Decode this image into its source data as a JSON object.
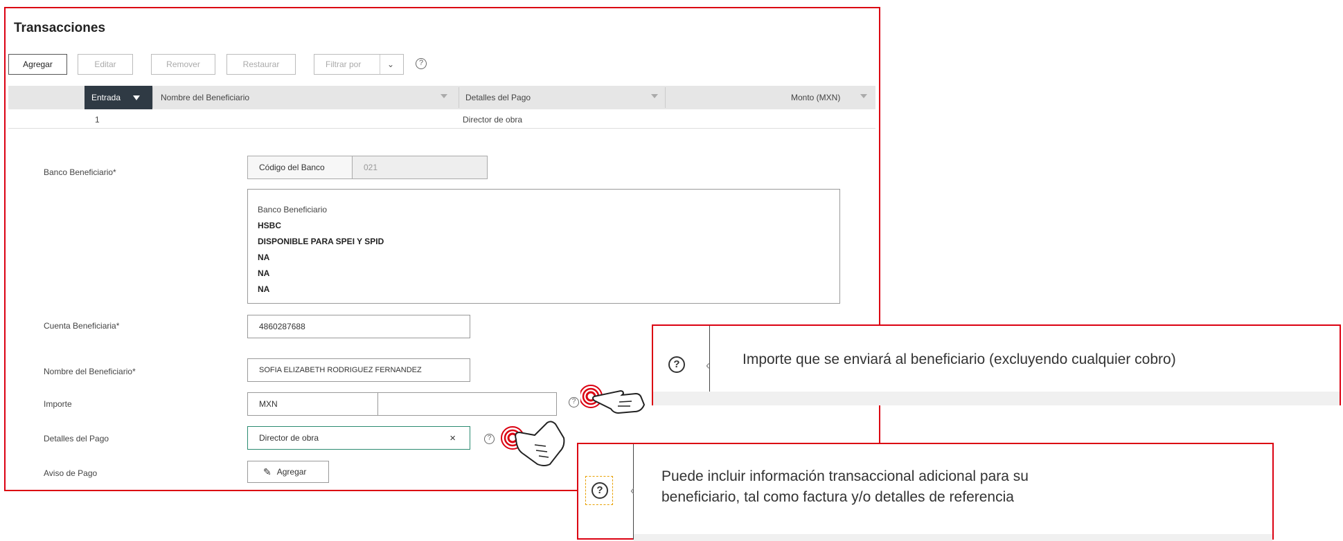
{
  "title": "Transacciones",
  "toolbar": {
    "add": "Agregar",
    "edit": "Editar",
    "remove": "Remover",
    "restore": "Restaurar",
    "filter": "Filtrar por",
    "help": "?"
  },
  "table": {
    "headers": [
      "Entrada",
      "Nombre del Beneficiario",
      "Detalles del Pago",
      "Monto (MXN)"
    ],
    "rows": [
      {
        "entrada": "1",
        "nombre": "",
        "detalles": "Director de obra",
        "monto": ""
      }
    ]
  },
  "form": {
    "banco_label": "Banco Beneficiario*",
    "codigo_label": "Código del Banco",
    "codigo_value": "021",
    "bank_info": [
      "Banco Beneficiario",
      "HSBC",
      "DISPONIBLE PARA SPEI Y SPID",
      "NA",
      "NA",
      "NA"
    ],
    "cuenta_label": "Cuenta Beneficiaria*",
    "cuenta_value": "4860287688",
    "nombre_label": "Nombre del Beneficiario*",
    "nombre_value": "SOFIA ELIZABETH RODRIGUEZ FERNANDEZ",
    "importe_label": "Importe",
    "importe_currency": "MXN",
    "importe_value": "",
    "detalles_label": "Detalles del Pago",
    "detalles_value": "Director de obra",
    "clear": "×",
    "aviso_label": "Aviso de Pago",
    "aviso_button": "Agregar"
  },
  "tooltips": {
    "importe": "Importe que se enviará al beneficiario (excluyendo cualquier cobro)",
    "detalles": [
      "Puede incluir información transaccional adicional para su",
      "beneficiario, tal como factura y/o detalles de referencia"
    ],
    "icon": "?"
  },
  "colors": {
    "accent": "#db0011",
    "header_dark": "#2f3a44",
    "header_bg": "#e6e6e6"
  }
}
